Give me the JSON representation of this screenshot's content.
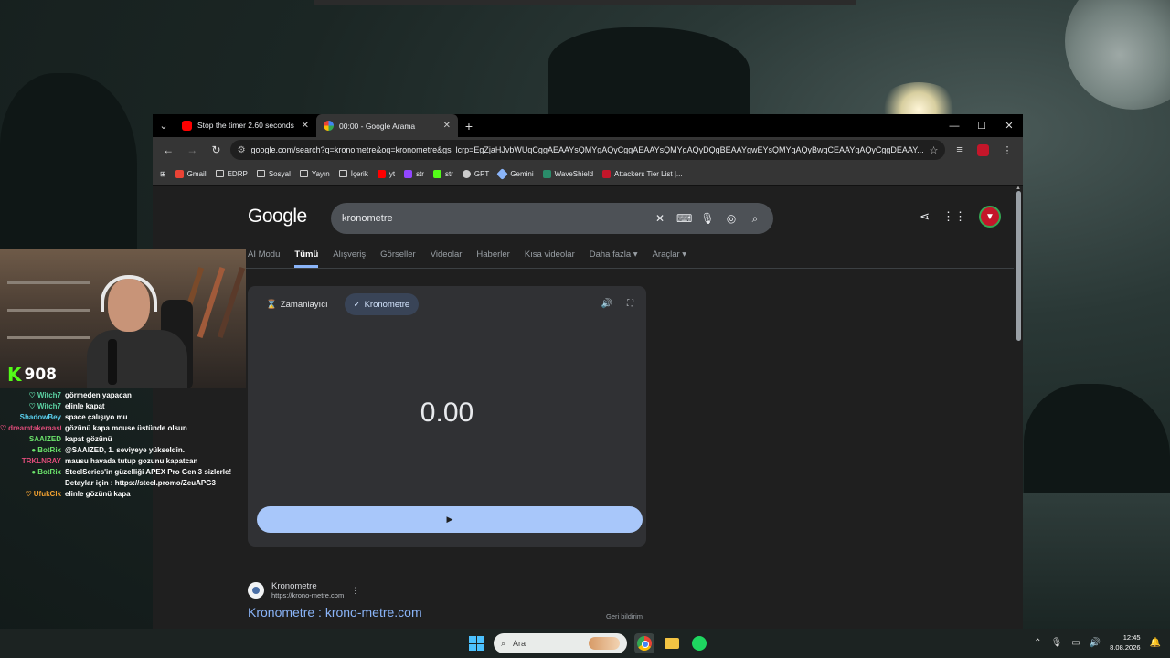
{
  "browser": {
    "tabs": [
      {
        "title": "Stop the timer 2.60 seconds 🤯",
        "favicon": "youtube-icon",
        "active": false
      },
      {
        "title": "00:00 - Google Arama",
        "favicon": "google-icon",
        "active": true
      }
    ],
    "url": "google.com/search?q=kronometre&oq=kronometre&gs_lcrp=EgZjaHJvbWUqCggAEAAYsQMYgAQyCggAEAAYsQMYgAQyDQgBEAAYgwEYsQMYgAQyBwgCEAAYgAQyCggDEAAY...",
    "bookmarks": [
      {
        "label": "Gmail",
        "icon": "gmail-icon",
        "color": "#ea4335"
      },
      {
        "label": "EDRP",
        "icon": "folder-icon"
      },
      {
        "label": "Sosyal",
        "icon": "folder-icon"
      },
      {
        "label": "Yayın",
        "icon": "folder-icon"
      },
      {
        "label": "İçerik",
        "icon": "folder-icon"
      },
      {
        "label": "yt",
        "icon": "youtube-icon",
        "color": "#ff0000"
      },
      {
        "label": "str",
        "icon": "twitch-icon",
        "color": "#9146ff"
      },
      {
        "label": "str",
        "icon": "kick-icon",
        "color": "#53fc18"
      },
      {
        "label": "GPT",
        "icon": "openai-icon",
        "color": "#cccccc"
      },
      {
        "label": "Gemini",
        "icon": "gemini-icon",
        "color": "#8ab4f8"
      },
      {
        "label": "WaveShield",
        "icon": "waveshield-icon",
        "color": "#2a8c6a"
      },
      {
        "label": "Attackers Tier List |...",
        "icon": "attackers-icon",
        "color": "#c4162a"
      }
    ]
  },
  "google": {
    "logo": "Google",
    "query": "kronometre",
    "filters": [
      "AI Modu",
      "Tümü",
      "Alışveriş",
      "Görseller",
      "Videolar",
      "Haberler",
      "Kısa videolar",
      "Daha fazla ▾",
      "Araçlar ▾"
    ],
    "active_filter_index": 1,
    "widget": {
      "tab_timer": "Zamanlayıcı",
      "tab_stopwatch": "Kronometre",
      "time": "0.00",
      "start_icon": "▶"
    },
    "feedback": "Geri bildirim",
    "result": {
      "site_name": "Kronometre",
      "site_url": "https://krono-metre.com",
      "title": "Kronometre : krono-metre.com"
    }
  },
  "stream": {
    "platform_icon": "K",
    "viewer_count": "908",
    "chat": [
      {
        "user": "Witch7",
        "color": "#5ad1a2",
        "badge": "♡",
        "text": "görmeden yapacan"
      },
      {
        "user": "Witch7",
        "color": "#5ad1a2",
        "badge": "♡",
        "text": "elinle kapat"
      },
      {
        "user": "ShadowBey",
        "color": "#5ad1f0",
        "badge": "",
        "text": "space çalışıyo mu"
      },
      {
        "user": "dreamtakeraas01",
        "color": "#e04c7a",
        "badge": "♡",
        "text": "gözünü kapa mouse üstünde olsun"
      },
      {
        "user": "SAAIZED",
        "color": "#6be36b",
        "badge": "",
        "text": "kapat gözünü"
      },
      {
        "user": "BotRix",
        "color": "#6be36b",
        "badge": "●",
        "text": "@SAAIZED, 1. seviyeye yükseldin."
      },
      {
        "user": "TRKLNRAY",
        "color": "#e04c7a",
        "badge": "",
        "text": "mausu havada tutup gozunu kapatcan"
      },
      {
        "user": "BotRix",
        "color": "#6be36b",
        "badge": "●",
        "text": "SteelSeries'in güzelliği APEX Pro Gen 3 sizlerle!"
      },
      {
        "user": "",
        "color": "#ffffff",
        "badge": "",
        "text": "Detaylar için : https://steel.promo/ZeuAPG3"
      },
      {
        "user": "UfukClk",
        "color": "#f0a030",
        "badge": "♡",
        "text": "elinle gözünü kapa"
      }
    ]
  },
  "taskbar": {
    "search_placeholder": "Ara",
    "time": "12:45",
    "date": "8.08.2026"
  }
}
